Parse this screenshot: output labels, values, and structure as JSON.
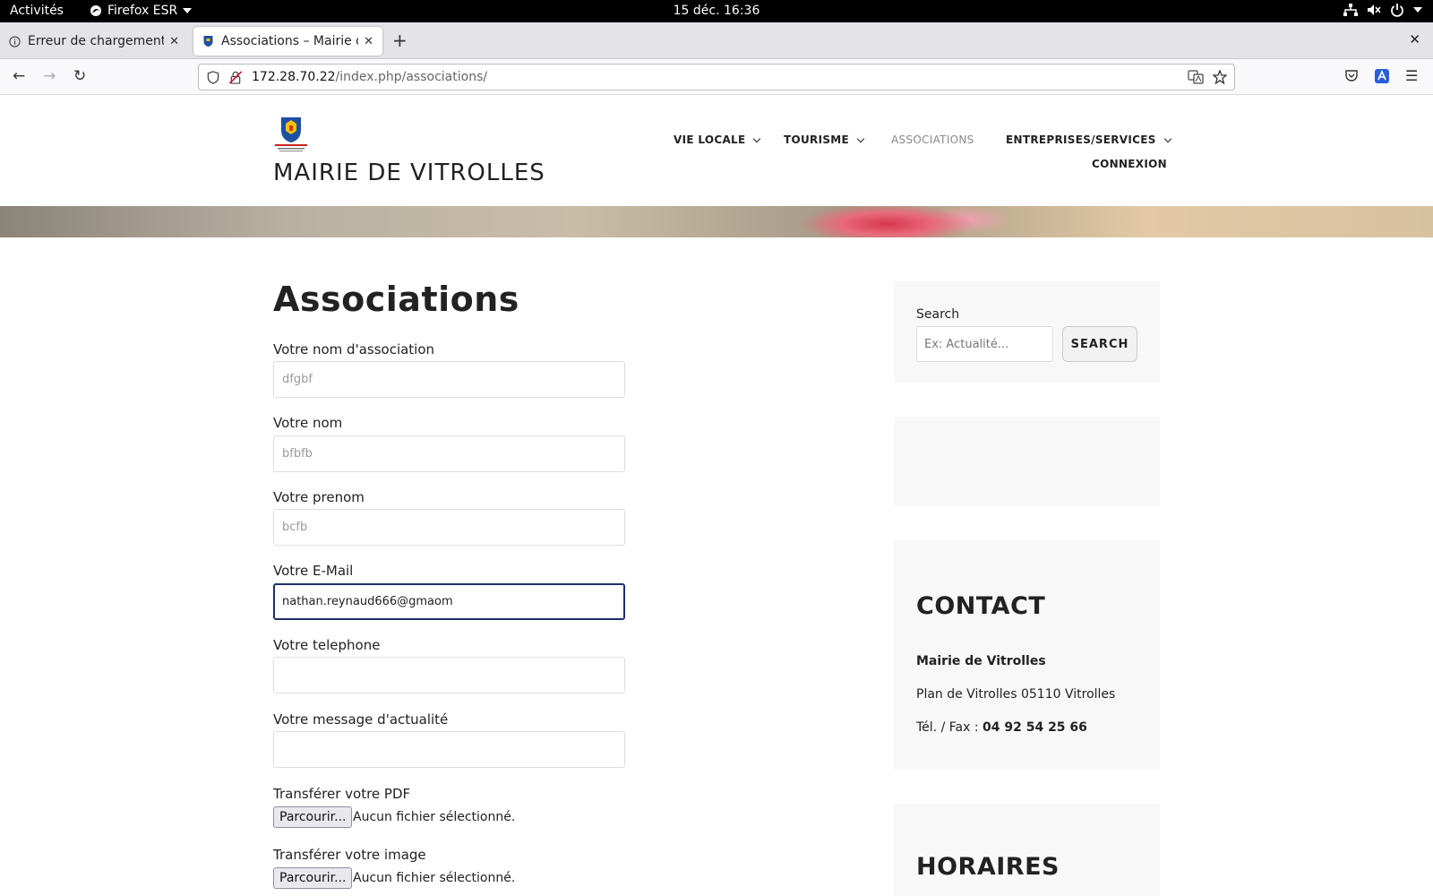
{
  "system_bar": {
    "activities": "Activités",
    "app_name": "Firefox ESR",
    "clock": "15 déc.  16:36"
  },
  "browser": {
    "tabs": [
      {
        "title": "Erreur de chargement de la"
      },
      {
        "title": "Associations – Mairie de Vitrolles"
      }
    ],
    "url_host": "172.28.70.22",
    "url_path": "/index.php/associations/"
  },
  "site": {
    "title": "MAIRIE DE VITROLLES",
    "nav": {
      "vie_locale": "VIE LOCALE",
      "tourisme": "TOURISME",
      "associations": "ASSOCIATIONS",
      "entreprises": "ENTREPRISES/SERVICES",
      "connexion": "CONNEXION"
    }
  },
  "form": {
    "heading": "Associations",
    "association_label": "Votre nom d'association",
    "association_value": "dfgbf",
    "nom_label": "Votre nom",
    "nom_value": "bfbfb",
    "prenom_label": "Votre prenom",
    "prenom_value": "bcfb",
    "email_label": "Votre E-Mail",
    "email_value": "nathan.reynaud666@gmaom",
    "telephone_label": "Votre telephone",
    "telephone_value": "",
    "message_label": "Votre message d'actualité",
    "message_value": "",
    "pdf_label": "Transférer votre PDF",
    "image_label": "Transférer votre image",
    "browse_label": "Parcourir...",
    "no_file": "Aucun fichier sélectionné."
  },
  "sidebar": {
    "search_label": "Search",
    "search_placeholder": "Ex: Actualité...",
    "search_button": "SEARCH",
    "contact_title": "CONTACT",
    "contact_name": "Mairie de Vitrolles",
    "contact_address": "Plan de Vitrolles 05110 Vitrolles",
    "contact_phone_label": "Tél. / Fax : ",
    "contact_phone": "04 92 54 25 66",
    "horaires_title": "HORAIRES"
  },
  "colors": {
    "focus_border": "#1c2e6b",
    "logo_blue": "#1d4fa3",
    "logo_gold": "#f2c500"
  }
}
